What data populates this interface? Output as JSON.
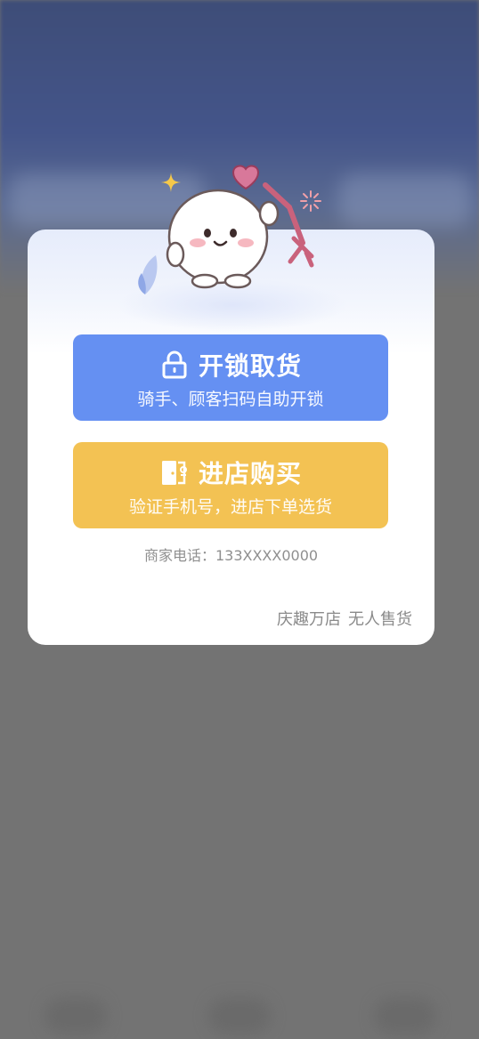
{
  "dialog": {
    "unlock_button": {
      "title": "开锁取货",
      "subtitle": "骑手、顾客扫码自助开锁",
      "icon": "lock-icon",
      "color": "#6590f2"
    },
    "enter_button": {
      "title": "进店购买",
      "subtitle": "验证手机号，进店下单选货",
      "icon": "door-icon",
      "color": "#f3c253"
    },
    "phone_label": "商家电话：",
    "phone_number": "133XXXX0000",
    "store_name": "庆趣万店",
    "store_type": "无人售货"
  },
  "colors": {
    "overlay": "#737373",
    "card_bg": "#ffffff",
    "secondary_text": "#8f8f8f"
  }
}
